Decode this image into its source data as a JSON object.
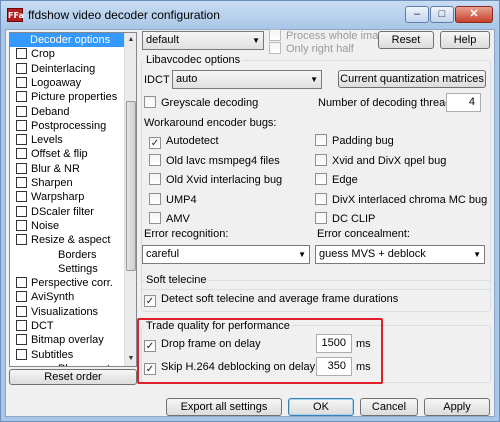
{
  "window": {
    "title": "ffdshow video decoder configuration",
    "app_icon": "ffdshow-icon",
    "min_glyph": "–",
    "max_glyph": "□",
    "close_glyph": "✕"
  },
  "sidebar": {
    "items": [
      {
        "label": "Decoder options",
        "checkbox": false,
        "selected": true
      },
      {
        "label": "Crop",
        "checkbox": true
      },
      {
        "label": "Deinterlacing",
        "checkbox": true
      },
      {
        "label": "Logoaway",
        "checkbox": true
      },
      {
        "label": "Picture properties",
        "checkbox": true
      },
      {
        "label": "Deband",
        "checkbox": true
      },
      {
        "label": "Postprocessing",
        "checkbox": true
      },
      {
        "label": "Levels",
        "checkbox": true
      },
      {
        "label": "Offset & flip",
        "checkbox": true
      },
      {
        "label": "Blur & NR",
        "checkbox": true
      },
      {
        "label": "Sharpen",
        "checkbox": true
      },
      {
        "label": "Warpsharp",
        "checkbox": true
      },
      {
        "label": "DScaler filter",
        "checkbox": true
      },
      {
        "label": "Noise",
        "checkbox": true
      },
      {
        "label": "Resize & aspect",
        "checkbox": true
      },
      {
        "label": "Borders",
        "checkbox": false,
        "indent": true
      },
      {
        "label": "Settings",
        "checkbox": false,
        "indent": true
      },
      {
        "label": "Perspective corr.",
        "checkbox": true
      },
      {
        "label": "AviSynth",
        "checkbox": true
      },
      {
        "label": "Visualizations",
        "checkbox": true
      },
      {
        "label": "DCT",
        "checkbox": true
      },
      {
        "label": "Bitmap overlay",
        "checkbox": true
      },
      {
        "label": "Subtitles",
        "checkbox": true
      },
      {
        "label": "Placement",
        "checkbox": false,
        "indent": true
      }
    ],
    "scroll_up_glyph": "▲",
    "scroll_down_glyph": "▼",
    "reset_order_label": "Reset order"
  },
  "top": {
    "preset_value": "default",
    "process_whole_image": "Process whole image",
    "only_right_half": "Only right half",
    "reset_label": "Reset",
    "help_label": "Help"
  },
  "libavcodec": {
    "group_title": "Libavcodec options",
    "idct_label": "IDCT",
    "idct_value": "auto",
    "quant_button": "Current quantization matrices",
    "greyscale_label": "Greyscale decoding",
    "threads_label": "Number of decoding threads:",
    "threads_value": "4",
    "workaround_label": "Workaround encoder bugs:",
    "bugs_left": [
      {
        "label": "Autodetect",
        "checked": true
      },
      {
        "label": "Old lavc msmpeg4 files",
        "checked": false
      },
      {
        "label": "Old Xvid interlacing bug",
        "checked": false
      },
      {
        "label": "UMP4",
        "checked": false
      },
      {
        "label": "AMV",
        "checked": false
      }
    ],
    "bugs_right": [
      {
        "label": "Padding bug",
        "checked": false
      },
      {
        "label": "Xvid and DivX qpel bug",
        "checked": false
      },
      {
        "label": "Edge",
        "checked": false
      },
      {
        "label": "DivX interlaced chroma MC bug",
        "checked": false
      },
      {
        "label": "DC CLIP",
        "checked": false
      }
    ],
    "error_recognition_label": "Error recognition:",
    "error_recognition_value": "careful",
    "error_concealment_label": "Error concealment:",
    "error_concealment_value": "guess MVS + deblock"
  },
  "telecine": {
    "group_title": "Soft telecine",
    "detect_label": "Detect soft telecine and average frame durations",
    "detect_checked": true
  },
  "trade": {
    "group_title": "Trade quality for performance",
    "drop_label": "Drop frame on delay",
    "drop_checked": true,
    "drop_value": "1500",
    "drop_unit": "ms",
    "skip_label": "Skip H.264 deblocking on delay",
    "skip_checked": true,
    "skip_value": "350",
    "skip_unit": "ms",
    "highlight_color": "#e0202a"
  },
  "footer": {
    "export_label": "Export all settings",
    "ok_label": "OK",
    "cancel_label": "Cancel",
    "apply_label": "Apply"
  },
  "glyphs": {
    "check": "✓",
    "dropdown": "▼"
  },
  "colors": {
    "selection": "#3399ff",
    "title_bar": "#a9c6e8",
    "close_button": "#c8402c"
  }
}
